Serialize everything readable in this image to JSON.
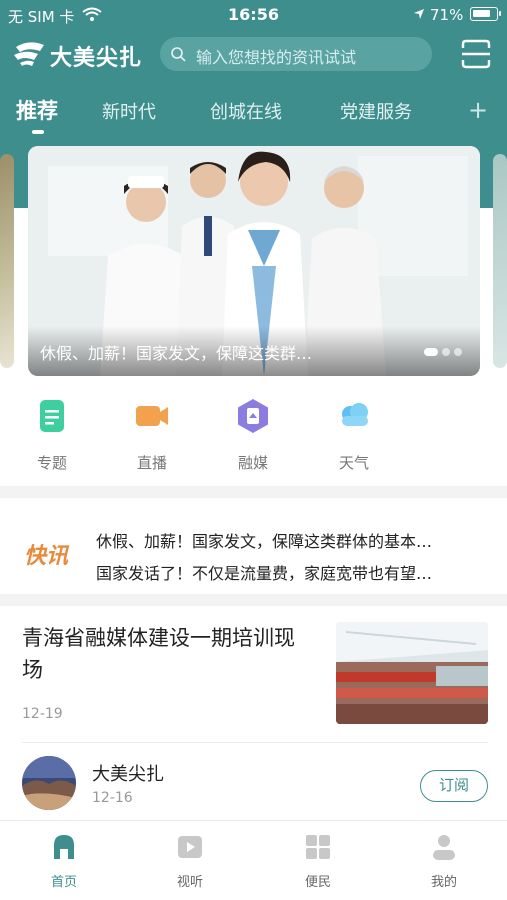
{
  "status_bar": {
    "carrier": "无 SIM 卡",
    "time": "16:56",
    "battery": "71%"
  },
  "header": {
    "app_name": "大美尖扎",
    "search_placeholder": "输入您想找的资讯试试",
    "accent_color": "#3f8e8e"
  },
  "tabs": [
    {
      "label": "推荐",
      "active": true
    },
    {
      "label": "新时代",
      "active": false
    },
    {
      "label": "创城在线",
      "active": false
    },
    {
      "label": "党建服务",
      "active": false
    }
  ],
  "tab_more_icon": "+",
  "banner": {
    "caption": "休假、加薪！国家发文，保障这类群…",
    "dots": 3,
    "active_dot": 0
  },
  "quick_links": [
    {
      "label": "专题",
      "icon": "document-icon",
      "color": "#3fcf9f"
    },
    {
      "label": "直播",
      "icon": "video-camera-icon",
      "color": "#f2a24f"
    },
    {
      "label": "融媒",
      "icon": "media-hexagon-icon",
      "color": "#8b7de0"
    },
    {
      "label": "天气",
      "icon": "cloud-icon",
      "color": "#5fc0f0"
    }
  ],
  "flash_news": {
    "tag": "快讯",
    "items": [
      "休假、加薪！国家发文，保障这类群体的基本…",
      "国家发话了！不仅是流量费，家庭宽带也有望…"
    ]
  },
  "news": [
    {
      "title": "青海省融媒体建设一期培训现场",
      "date": "12-19"
    }
  ],
  "subscription": {
    "name": "大美尖扎",
    "date": "12-16",
    "button": "订阅"
  },
  "bottom_nav": [
    {
      "label": "首页",
      "icon": "home-icon",
      "active": true
    },
    {
      "label": "视听",
      "icon": "play-icon",
      "active": false
    },
    {
      "label": "便民",
      "icon": "grid-icon",
      "active": false
    },
    {
      "label": "我的",
      "icon": "user-icon",
      "active": false
    }
  ]
}
